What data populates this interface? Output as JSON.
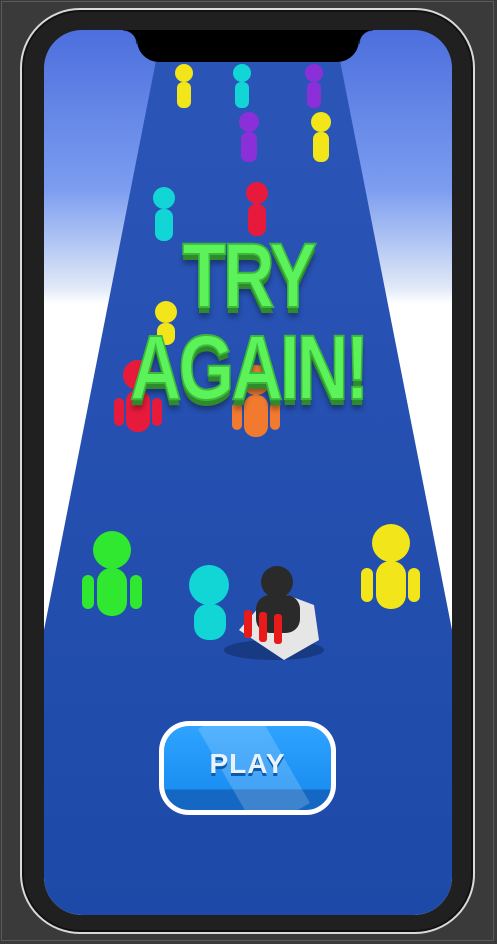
{
  "game": {
    "result_text": "TRY AGAIN!",
    "play_label": "PLAY"
  },
  "colors": {
    "track": "#1d4aa8",
    "try_again": "#5cf25a",
    "play_button": "#1b8ff2"
  },
  "crowd": [
    {
      "color": "#f2e51a"
    },
    {
      "color": "#12d6d6"
    },
    {
      "color": "#8b2fd9"
    },
    {
      "color": "#8b2fd9"
    },
    {
      "color": "#f2e51a"
    },
    {
      "color": "#12d6d6"
    },
    {
      "color": "#e81a3c"
    },
    {
      "color": "#f2e51a"
    },
    {
      "color": "#e81a3c"
    },
    {
      "color": "#f27a2f"
    },
    {
      "color": "#2fe82f"
    },
    {
      "color": "#12d6d6"
    },
    {
      "color": "#f2e51a"
    }
  ],
  "player": {
    "color": "#2a2a2a",
    "accent": "#e81a1a"
  }
}
